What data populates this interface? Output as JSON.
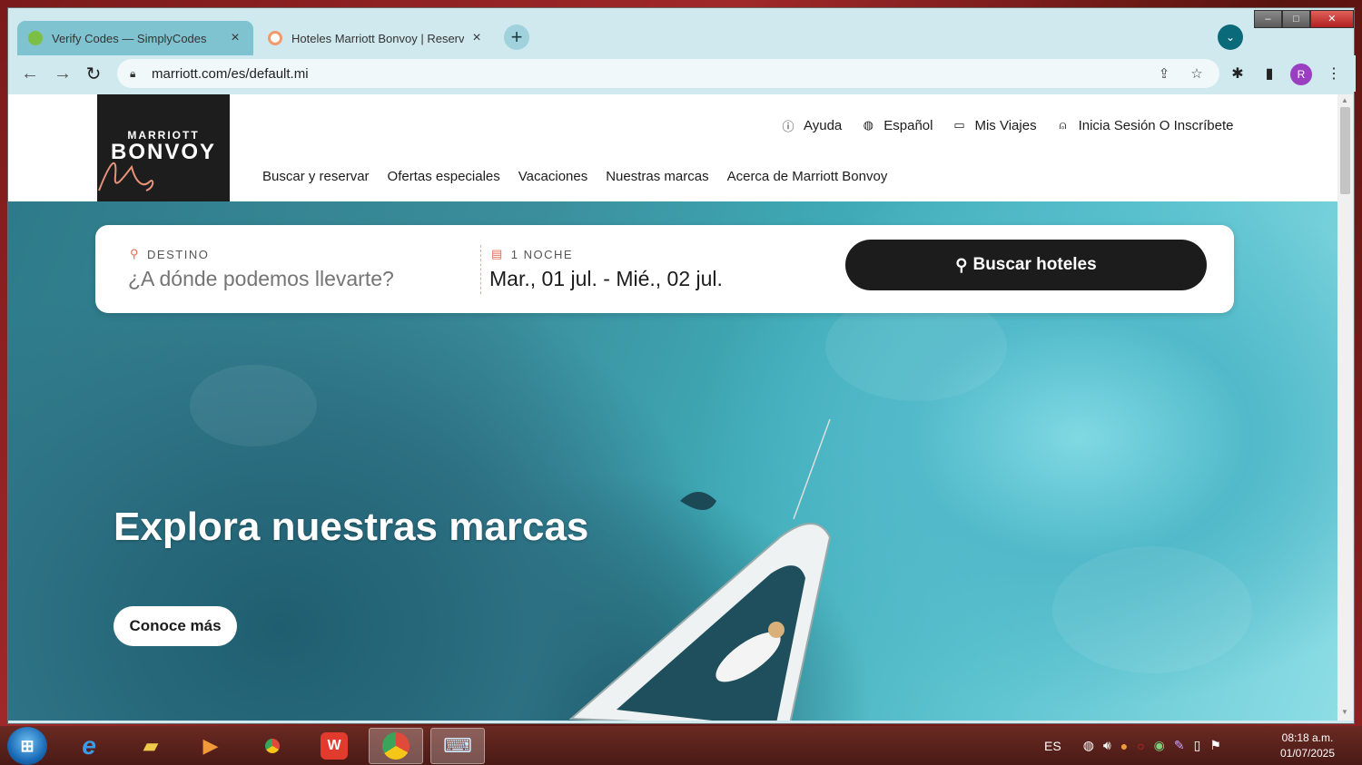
{
  "browser": {
    "tabs": [
      {
        "title": "Verify Codes — SimplyCodes",
        "icon": "simplycodes-icon",
        "active": false
      },
      {
        "title": "Hoteles Marriott Bonvoy | Reservas",
        "icon": "marriott-favicon",
        "active": true
      }
    ],
    "new_tab_label": "+",
    "url": "marriott.com/es/default.mi",
    "profile_initial": "R"
  },
  "site": {
    "logo": {
      "line1": "MARRIOTT",
      "line2": "BONVOY"
    },
    "utility_nav": {
      "help": "Ayuda",
      "language": "Español",
      "trips": "Mis Viajes",
      "sign_in": "Inicia Sesión O Inscríbete"
    },
    "main_nav": [
      "Buscar y reservar",
      "Ofertas especiales",
      "Vacaciones",
      "Nuestras marcas",
      "Acerca de Marriott Bonvoy"
    ]
  },
  "search": {
    "destination_label": "DESTINO",
    "destination_placeholder": "¿A dónde podemos llevarte?",
    "nights_label": "1 NOCHE",
    "dates_value": "Mar., 01 jul. - Mié., 02 jul.",
    "button_label": "Buscar hoteles"
  },
  "hero": {
    "title": "Explora nuestras marcas",
    "cta_label": "Conoce más"
  },
  "taskbar": {
    "language": "ES",
    "time": "08:18 a.m.",
    "date": "01/07/2025"
  },
  "colors": {
    "brand_dark": "#1c1c1c",
    "accent_pin": "#e06b54",
    "chrome_frame": "#cfe9ef",
    "active_tab_indicator": "#7fc3d0"
  }
}
